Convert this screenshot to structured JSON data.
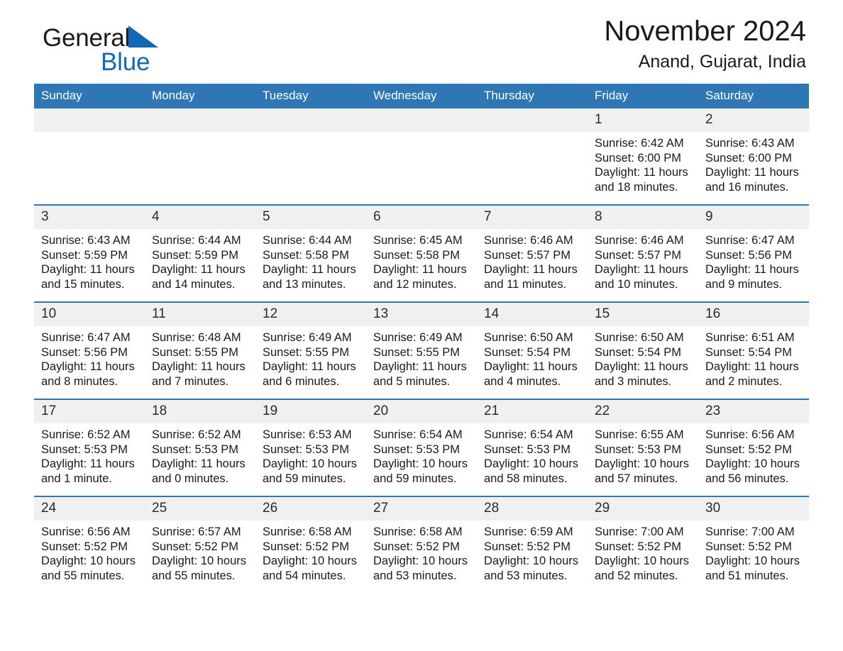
{
  "brand": {
    "word1": "General",
    "word2": "Blue",
    "triangle_color": "#1268b3"
  },
  "header": {
    "title": "November 2024",
    "subtitle": "Anand, Gujarat, India"
  },
  "theme": {
    "header_blue": "#2f76b5",
    "daynum_band": "#f0f0f0",
    "text": "#1a1a1a"
  },
  "weekdays": [
    "Sunday",
    "Monday",
    "Tuesday",
    "Wednesday",
    "Thursday",
    "Friday",
    "Saturday"
  ],
  "labels": {
    "sunrise_prefix": "Sunrise: ",
    "sunset_prefix": "Sunset: ",
    "daylight_prefix": "Daylight: "
  },
  "weeks": [
    [
      {
        "day": "",
        "empty": true
      },
      {
        "day": "",
        "empty": true
      },
      {
        "day": "",
        "empty": true
      },
      {
        "day": "",
        "empty": true
      },
      {
        "day": "",
        "empty": true
      },
      {
        "day": "1",
        "sunrise": "Sunrise: 6:42 AM",
        "sunset": "Sunset: 6:00 PM",
        "daylight": "Daylight: 11 hours and 18 minutes."
      },
      {
        "day": "2",
        "sunrise": "Sunrise: 6:43 AM",
        "sunset": "Sunset: 6:00 PM",
        "daylight": "Daylight: 11 hours and 16 minutes."
      }
    ],
    [
      {
        "day": "3",
        "sunrise": "Sunrise: 6:43 AM",
        "sunset": "Sunset: 5:59 PM",
        "daylight": "Daylight: 11 hours and 15 minutes."
      },
      {
        "day": "4",
        "sunrise": "Sunrise: 6:44 AM",
        "sunset": "Sunset: 5:59 PM",
        "daylight": "Daylight: 11 hours and 14 minutes."
      },
      {
        "day": "5",
        "sunrise": "Sunrise: 6:44 AM",
        "sunset": "Sunset: 5:58 PM",
        "daylight": "Daylight: 11 hours and 13 minutes."
      },
      {
        "day": "6",
        "sunrise": "Sunrise: 6:45 AM",
        "sunset": "Sunset: 5:58 PM",
        "daylight": "Daylight: 11 hours and 12 minutes."
      },
      {
        "day": "7",
        "sunrise": "Sunrise: 6:46 AM",
        "sunset": "Sunset: 5:57 PM",
        "daylight": "Daylight: 11 hours and 11 minutes."
      },
      {
        "day": "8",
        "sunrise": "Sunrise: 6:46 AM",
        "sunset": "Sunset: 5:57 PM",
        "daylight": "Daylight: 11 hours and 10 minutes."
      },
      {
        "day": "9",
        "sunrise": "Sunrise: 6:47 AM",
        "sunset": "Sunset: 5:56 PM",
        "daylight": "Daylight: 11 hours and 9 minutes."
      }
    ],
    [
      {
        "day": "10",
        "sunrise": "Sunrise: 6:47 AM",
        "sunset": "Sunset: 5:56 PM",
        "daylight": "Daylight: 11 hours and 8 minutes."
      },
      {
        "day": "11",
        "sunrise": "Sunrise: 6:48 AM",
        "sunset": "Sunset: 5:55 PM",
        "daylight": "Daylight: 11 hours and 7 minutes."
      },
      {
        "day": "12",
        "sunrise": "Sunrise: 6:49 AM",
        "sunset": "Sunset: 5:55 PM",
        "daylight": "Daylight: 11 hours and 6 minutes."
      },
      {
        "day": "13",
        "sunrise": "Sunrise: 6:49 AM",
        "sunset": "Sunset: 5:55 PM",
        "daylight": "Daylight: 11 hours and 5 minutes."
      },
      {
        "day": "14",
        "sunrise": "Sunrise: 6:50 AM",
        "sunset": "Sunset: 5:54 PM",
        "daylight": "Daylight: 11 hours and 4 minutes."
      },
      {
        "day": "15",
        "sunrise": "Sunrise: 6:50 AM",
        "sunset": "Sunset: 5:54 PM",
        "daylight": "Daylight: 11 hours and 3 minutes."
      },
      {
        "day": "16",
        "sunrise": "Sunrise: 6:51 AM",
        "sunset": "Sunset: 5:54 PM",
        "daylight": "Daylight: 11 hours and 2 minutes."
      }
    ],
    [
      {
        "day": "17",
        "sunrise": "Sunrise: 6:52 AM",
        "sunset": "Sunset: 5:53 PM",
        "daylight": "Daylight: 11 hours and 1 minute."
      },
      {
        "day": "18",
        "sunrise": "Sunrise: 6:52 AM",
        "sunset": "Sunset: 5:53 PM",
        "daylight": "Daylight: 11 hours and 0 minutes."
      },
      {
        "day": "19",
        "sunrise": "Sunrise: 6:53 AM",
        "sunset": "Sunset: 5:53 PM",
        "daylight": "Daylight: 10 hours and 59 minutes."
      },
      {
        "day": "20",
        "sunrise": "Sunrise: 6:54 AM",
        "sunset": "Sunset: 5:53 PM",
        "daylight": "Daylight: 10 hours and 59 minutes."
      },
      {
        "day": "21",
        "sunrise": "Sunrise: 6:54 AM",
        "sunset": "Sunset: 5:53 PM",
        "daylight": "Daylight: 10 hours and 58 minutes."
      },
      {
        "day": "22",
        "sunrise": "Sunrise: 6:55 AM",
        "sunset": "Sunset: 5:53 PM",
        "daylight": "Daylight: 10 hours and 57 minutes."
      },
      {
        "day": "23",
        "sunrise": "Sunrise: 6:56 AM",
        "sunset": "Sunset: 5:52 PM",
        "daylight": "Daylight: 10 hours and 56 minutes."
      }
    ],
    [
      {
        "day": "24",
        "sunrise": "Sunrise: 6:56 AM",
        "sunset": "Sunset: 5:52 PM",
        "daylight": "Daylight: 10 hours and 55 minutes."
      },
      {
        "day": "25",
        "sunrise": "Sunrise: 6:57 AM",
        "sunset": "Sunset: 5:52 PM",
        "daylight": "Daylight: 10 hours and 55 minutes."
      },
      {
        "day": "26",
        "sunrise": "Sunrise: 6:58 AM",
        "sunset": "Sunset: 5:52 PM",
        "daylight": "Daylight: 10 hours and 54 minutes."
      },
      {
        "day": "27",
        "sunrise": "Sunrise: 6:58 AM",
        "sunset": "Sunset: 5:52 PM",
        "daylight": "Daylight: 10 hours and 53 minutes."
      },
      {
        "day": "28",
        "sunrise": "Sunrise: 6:59 AM",
        "sunset": "Sunset: 5:52 PM",
        "daylight": "Daylight: 10 hours and 53 minutes."
      },
      {
        "day": "29",
        "sunrise": "Sunrise: 7:00 AM",
        "sunset": "Sunset: 5:52 PM",
        "daylight": "Daylight: 10 hours and 52 minutes."
      },
      {
        "day": "30",
        "sunrise": "Sunrise: 7:00 AM",
        "sunset": "Sunset: 5:52 PM",
        "daylight": "Daylight: 10 hours and 51 minutes."
      }
    ]
  ]
}
